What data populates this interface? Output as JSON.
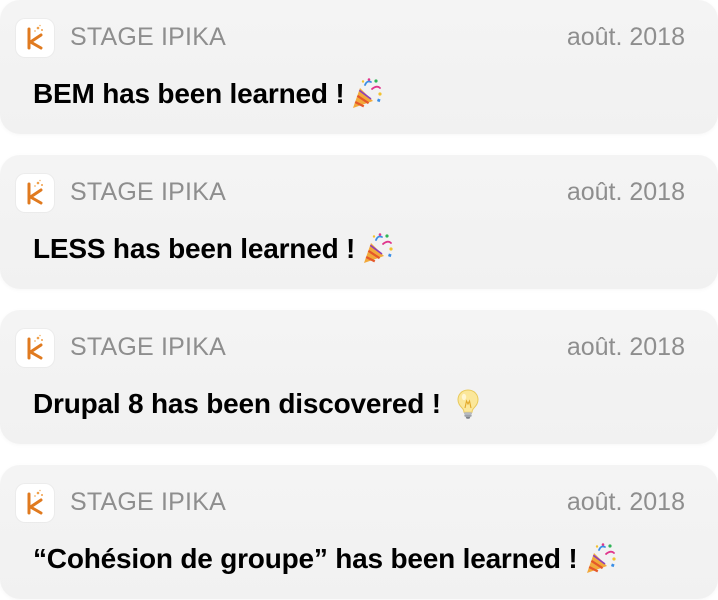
{
  "notifications": [
    {
      "app_name": "STAGE IPIKA",
      "app_icon": "ipika-k-logo-icon",
      "date": "août. 2018",
      "message": "BEM has been learned !",
      "emoji": "party-popper-icon"
    },
    {
      "app_name": "STAGE IPIKA",
      "app_icon": "ipika-k-logo-icon",
      "date": "août. 2018",
      "message": "LESS has been learned !",
      "emoji": "party-popper-icon"
    },
    {
      "app_name": "STAGE IPIKA",
      "app_icon": "ipika-k-logo-icon",
      "date": "août. 2018",
      "message": "Drupal 8 has been discovered !",
      "emoji": "light-bulb-icon"
    },
    {
      "app_name": "STAGE IPIKA",
      "app_icon": "ipika-k-logo-icon",
      "date": "août. 2018",
      "message": "“Cohésion de groupe” has been learned !",
      "emoji": "party-popper-icon"
    }
  ],
  "colors": {
    "card_background": "#f3f3f3",
    "app_name": "#8e8e8e",
    "date": "#8e8e8e",
    "message": "#000000",
    "logo_orange": "#e07a1f"
  }
}
